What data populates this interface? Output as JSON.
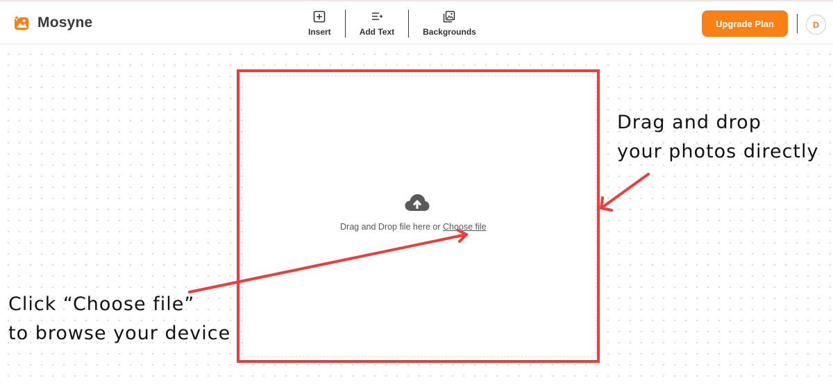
{
  "app": {
    "brand": "Mosyne",
    "accent": "#f88015",
    "annotation_color": "#ee3b3b"
  },
  "toolbar": {
    "items": [
      {
        "label": "Insert",
        "icon": "plus-square-icon"
      },
      {
        "label": "Add Text",
        "icon": "add-text-icon"
      },
      {
        "label": "Backgrounds",
        "icon": "images-icon"
      }
    ]
  },
  "header": {
    "upgrade_label": "Upgrade Plan",
    "avatar_initial": "D"
  },
  "dropzone": {
    "icon": "cloud-upload-icon",
    "text": "Drag and Drop file here or ",
    "link": "Choose file"
  },
  "annotations": {
    "right": {
      "line1": "Drag and drop",
      "line2": "your photos directly"
    },
    "left": {
      "line1": "Click “Choose file”",
      "line2": "to browse your device"
    }
  }
}
